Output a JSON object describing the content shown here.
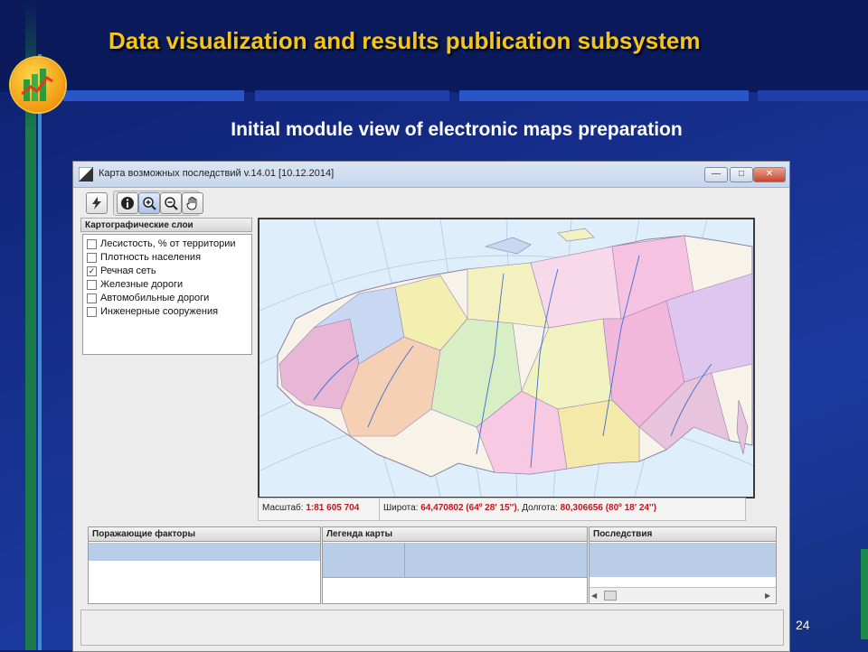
{
  "slide": {
    "title": "Data visualization and results publication subsystem",
    "subtitle": "Initial module view of electronic maps preparation",
    "page_number": "24"
  },
  "window": {
    "title": "Карта возможных последствий v.14.01 [10.12.2014]",
    "controls": {
      "minimize": "—",
      "maximize": "□",
      "close": "✕"
    }
  },
  "toolbar": {
    "icons": [
      "lightning-icon",
      "info-icon",
      "zoom-in-icon",
      "zoom-out-icon",
      "hand-pan-icon"
    ]
  },
  "layers_panel": {
    "header": "Картографические слои",
    "items": [
      {
        "label": "Лесистость, % от территории",
        "checked": false
      },
      {
        "label": "Плотность населения",
        "checked": false
      },
      {
        "label": "Речная сеть",
        "checked": true
      },
      {
        "label": "Железные дороги",
        "checked": false
      },
      {
        "label": "Автомобильные дороги",
        "checked": false
      },
      {
        "label": "Инженерные сооружения",
        "checked": false
      }
    ]
  },
  "status": {
    "scale_label": "Масштаб:",
    "scale_value": "1:81 605 704",
    "lat_label": "Широта:",
    "lat_value": "64,470802 (64º 28' 15'')",
    "lon_label": ", Долгота:",
    "lon_value": "80,306656 (80º 18' 24'')"
  },
  "tables": {
    "factors_header": "Поражающие факторы",
    "legend_header": "Легенда карты",
    "consequences_header": "Последствия"
  },
  "colors": {
    "title_yellow": "#f5c518",
    "background_blue": "#17318f",
    "status_value_red": "#c4151c",
    "selection_blue": "#b9cce8"
  }
}
